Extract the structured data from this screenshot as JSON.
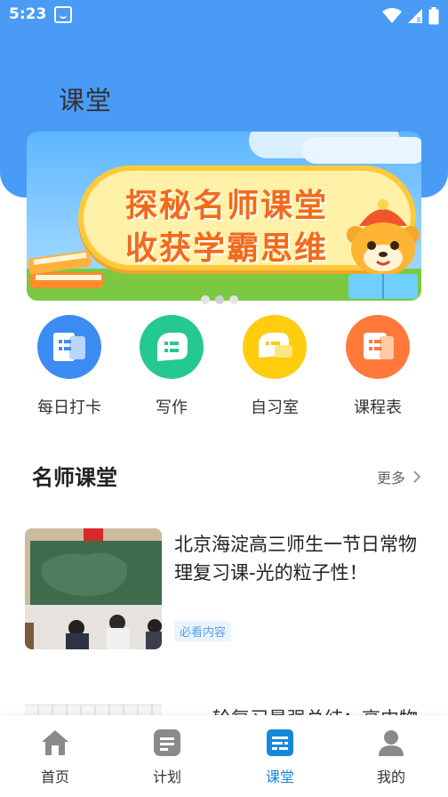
{
  "status_bar": {
    "time": "5:23"
  },
  "header": {
    "title": "课堂"
  },
  "banner": {
    "line1": "探秘名师课堂",
    "line2": "收获学霸思维",
    "dots_total": 3,
    "active_dot": 2
  },
  "quick_actions": [
    {
      "label": "每日打卡",
      "icon": "book-icon",
      "color": "#3d8cf3"
    },
    {
      "label": "写作",
      "icon": "chat-icon",
      "color": "#25c98f"
    },
    {
      "label": "自习室",
      "icon": "chat-icon",
      "color": "#ffcc10"
    },
    {
      "label": "课程表",
      "icon": "notes-icon",
      "color": "#ff7a3a"
    }
  ],
  "section": {
    "title": "名师课堂",
    "more_label": "更多"
  },
  "lessons": [
    {
      "title": "北京海淀高三师生一节日常物理复习课-光的粒子性！",
      "tag": "必看内容"
    },
    {
      "title": "一轮复习最强总结：高中物"
    }
  ],
  "tabbar": {
    "items": [
      {
        "label": "首页",
        "icon": "home-icon"
      },
      {
        "label": "计划",
        "icon": "plan-icon"
      },
      {
        "label": "课堂",
        "icon": "classroom-icon",
        "active": true
      },
      {
        "label": "我的",
        "icon": "user-icon"
      }
    ],
    "active_color": "#1588d8",
    "inactive_color": "#8a8a8a"
  },
  "colors": {
    "header_bg": "#4a9bf5",
    "tag_text": "#5a9fe8"
  }
}
